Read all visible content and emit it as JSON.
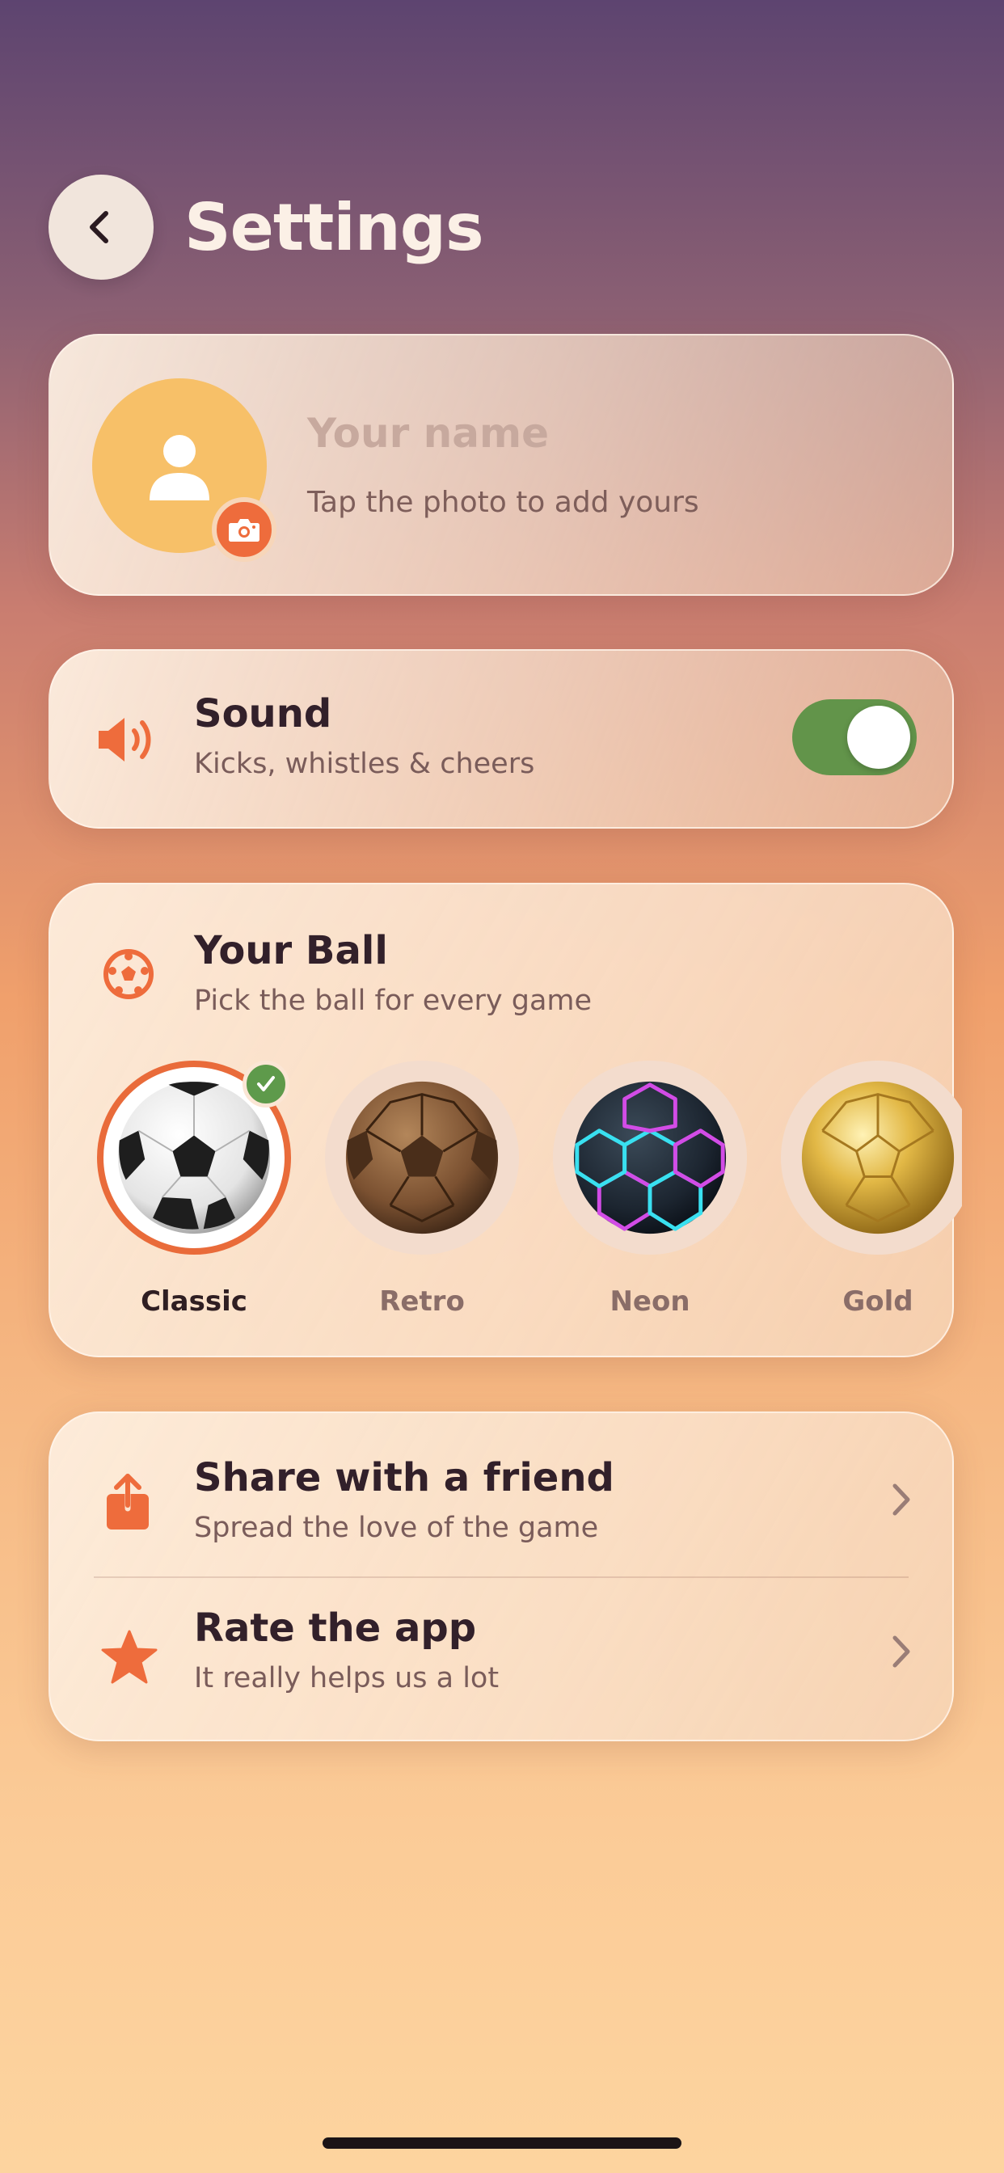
{
  "header": {
    "title": "Settings",
    "back_icon": "chevron-left-icon"
  },
  "profile": {
    "name_placeholder": "Your name",
    "hint": "Tap the photo to add yours",
    "avatar_icon": "person-icon",
    "badge_icon": "camera-icon"
  },
  "sound": {
    "icon": "speaker-icon",
    "title": "Sound",
    "subtitle": "Kicks, whistles & cheers",
    "enabled": true
  },
  "ball": {
    "icon": "soccer-ball-icon",
    "title": "Your Ball",
    "subtitle": "Pick the ball for every game",
    "selected": "Classic",
    "options": [
      {
        "label": "Classic"
      },
      {
        "label": "Retro"
      },
      {
        "label": "Neon"
      },
      {
        "label": "Gold"
      }
    ]
  },
  "links": [
    {
      "icon": "share-icon",
      "title": "Share with a friend",
      "subtitle": "Spread the love of the game"
    },
    {
      "icon": "star-icon",
      "title": "Rate the app",
      "subtitle": "It really helps us a lot"
    }
  ],
  "colors": {
    "accent": "#ee6c3c",
    "toggle_on": "#62944a",
    "check": "#5e9a4b",
    "avatar": "#f7c068"
  }
}
